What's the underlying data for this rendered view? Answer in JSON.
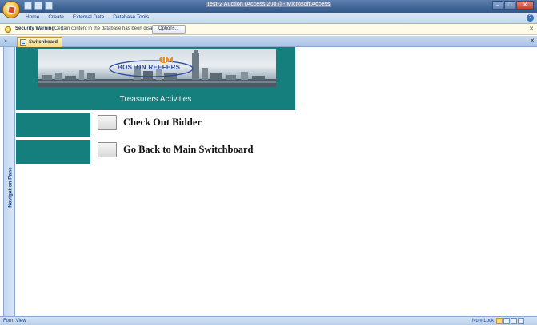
{
  "window": {
    "title_text": "Test-2 Auction (Access 2007) - Microsoft Access"
  },
  "ribbon": {
    "tabs": [
      "Home",
      "Create",
      "External Data",
      "Database Tools"
    ]
  },
  "security_bar": {
    "title": "Security Warning",
    "message": "Certain content in the database has been disabled",
    "options_label": "Options..."
  },
  "document_tab": {
    "label": "Switchboard"
  },
  "nav_pane": {
    "label": "Navigation Pane"
  },
  "form": {
    "logo_text": "BOSTON REEFERS",
    "header_title": "Treasurers Activities",
    "items": [
      {
        "label": "Check Out Bidder"
      },
      {
        "label": "Go Back to Main Switchboard"
      }
    ]
  },
  "status_bar": {
    "left": "Form View",
    "num_lock": "Num Lock"
  },
  "colors": {
    "teal": "#147f7c",
    "title_bar": "#3f6596",
    "ribbon": "#d9e6f5"
  }
}
